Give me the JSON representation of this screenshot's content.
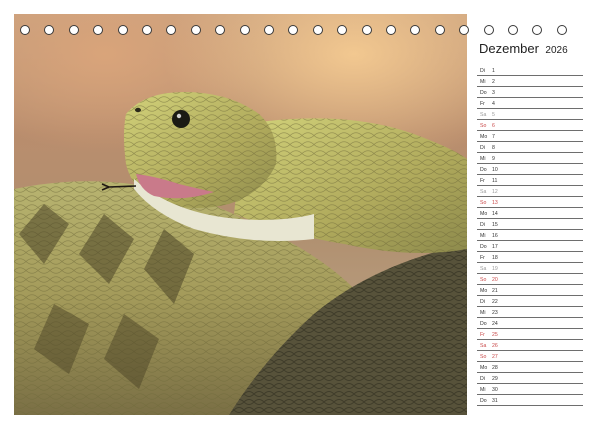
{
  "calendar": {
    "month": "Dezember",
    "year": "2026",
    "days": [
      {
        "wd": "Di",
        "d": "1",
        "type": ""
      },
      {
        "wd": "Mi",
        "d": "2",
        "type": ""
      },
      {
        "wd": "Do",
        "d": "3",
        "type": ""
      },
      {
        "wd": "Fr",
        "d": "4",
        "type": ""
      },
      {
        "wd": "Sa",
        "d": "5",
        "type": "sat"
      },
      {
        "wd": "So",
        "d": "6",
        "type": "sun"
      },
      {
        "wd": "Mo",
        "d": "7",
        "type": ""
      },
      {
        "wd": "Di",
        "d": "8",
        "type": ""
      },
      {
        "wd": "Mi",
        "d": "9",
        "type": ""
      },
      {
        "wd": "Do",
        "d": "10",
        "type": ""
      },
      {
        "wd": "Fr",
        "d": "11",
        "type": ""
      },
      {
        "wd": "Sa",
        "d": "12",
        "type": "sat"
      },
      {
        "wd": "So",
        "d": "13",
        "type": "sun"
      },
      {
        "wd": "Mo",
        "d": "14",
        "type": ""
      },
      {
        "wd": "Di",
        "d": "15",
        "type": ""
      },
      {
        "wd": "Mi",
        "d": "16",
        "type": ""
      },
      {
        "wd": "Do",
        "d": "17",
        "type": ""
      },
      {
        "wd": "Fr",
        "d": "18",
        "type": ""
      },
      {
        "wd": "Sa",
        "d": "19",
        "type": "sat"
      },
      {
        "wd": "So",
        "d": "20",
        "type": "sun"
      },
      {
        "wd": "Mo",
        "d": "21",
        "type": ""
      },
      {
        "wd": "Di",
        "d": "22",
        "type": ""
      },
      {
        "wd": "Mi",
        "d": "23",
        "type": ""
      },
      {
        "wd": "Do",
        "d": "24",
        "type": ""
      },
      {
        "wd": "Fr",
        "d": "25",
        "type": "sun"
      },
      {
        "wd": "Sa",
        "d": "26",
        "type": "sun"
      },
      {
        "wd": "So",
        "d": "27",
        "type": "sun"
      },
      {
        "wd": "Mo",
        "d": "28",
        "type": ""
      },
      {
        "wd": "Di",
        "d": "29",
        "type": ""
      },
      {
        "wd": "Mi",
        "d": "30",
        "type": ""
      },
      {
        "wd": "Do",
        "d": "31",
        "type": ""
      }
    ]
  },
  "colors": {
    "sunday_holiday": "#c94a4a",
    "saturday": "#9a9a9a",
    "ring": "#3a3a3a"
  },
  "binding": {
    "ring_count": 23
  }
}
